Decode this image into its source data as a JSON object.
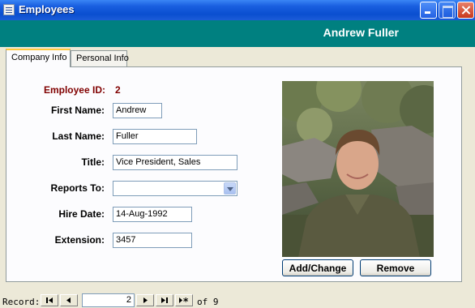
{
  "window": {
    "title": "Employees"
  },
  "header": {
    "employee_name": "Andrew Fuller"
  },
  "tabs": [
    {
      "label": "Company Info",
      "active": true
    },
    {
      "label": "Personal Info",
      "active": false
    }
  ],
  "form": {
    "employee_id_label": "Employee ID:",
    "employee_id": "2",
    "first_name_label": "First Name:",
    "first_name": "Andrew",
    "last_name_label": "Last Name:",
    "last_name": "Fuller",
    "title_label": "Title:",
    "title": "Vice President, Sales",
    "reports_to_label": "Reports To:",
    "reports_to": "",
    "hire_date_label": "Hire Date:",
    "hire_date": "14-Aug-1992",
    "extension_label": "Extension:",
    "extension": "3457"
  },
  "photo": {
    "add_label": "Add/Change",
    "remove_label": "Remove"
  },
  "navigator": {
    "record_label": "Record:",
    "current": "2",
    "of_text": "of 9"
  },
  "colors": {
    "header_band": "#008080",
    "label_accent": "#800000",
    "titlebar": "#0a4fd0"
  }
}
